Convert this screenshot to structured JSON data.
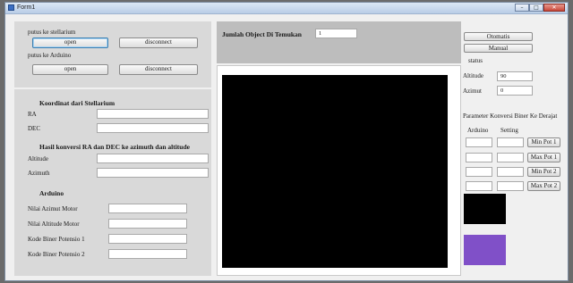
{
  "window": {
    "title": "Form1",
    "controls": [
      "–",
      "□",
      "✕"
    ]
  },
  "top_left": {
    "stellarium_label": "putus ke stellarium",
    "stellarium_open": "open",
    "stellarium_disconnect": "disconnect",
    "arduino_label": "putus ke Arduino",
    "arduino_open": "open",
    "arduino_disconnect": "disconnect"
  },
  "koordinat": {
    "heading": "Koordinat dari Stellarium",
    "ra_label": "RA",
    "ra_value": "",
    "dec_label": "DEC",
    "dec_value": ""
  },
  "konversi": {
    "heading": "Hasil konversi RA dan DEC ke azimuth dan altitude",
    "altitude_label": "Altitude",
    "altitude_value": "",
    "azimuth_label": "Azimuth",
    "azimuth_value": ""
  },
  "arduino": {
    "heading": "Arduino",
    "azimut_motor_label": "Nilai Azimut Motor",
    "azimut_motor_value": "",
    "altitude_motor_label": "Nilai Altitude Motor",
    "altitude_motor_value": "",
    "pot1_label": "Kode Biner  Potensio 1",
    "pot1_value": "",
    "pot2_label": "Kode Biner  Potensio 2",
    "pot2_value": ""
  },
  "object": {
    "label": "Jumlah Object Di Temukan",
    "value": "1"
  },
  "right": {
    "otomatis_button": "Otomatis",
    "manual_button": "Manual",
    "status_label": "status",
    "altitude_label": "Altitude",
    "altitude_value": "90",
    "azimut_label": "Azimut",
    "azimut_value": "0",
    "param_heading": "Parameter Konversi Biner Ke Derajat",
    "col_arduino": "Arduino",
    "col_setting": "Setting",
    "rows": [
      {
        "button": "Min Pot 1",
        "arduino": "",
        "setting": ""
      },
      {
        "button": "Max Pot 1",
        "arduino": "",
        "setting": ""
      },
      {
        "button": "Min Pot 2",
        "arduino": "",
        "setting": ""
      },
      {
        "button": "Max Pot 2",
        "arduino": "",
        "setting": ""
      }
    ]
  },
  "colors": {
    "black_swatch": "#000000",
    "purple_swatch": "#8050c8"
  }
}
